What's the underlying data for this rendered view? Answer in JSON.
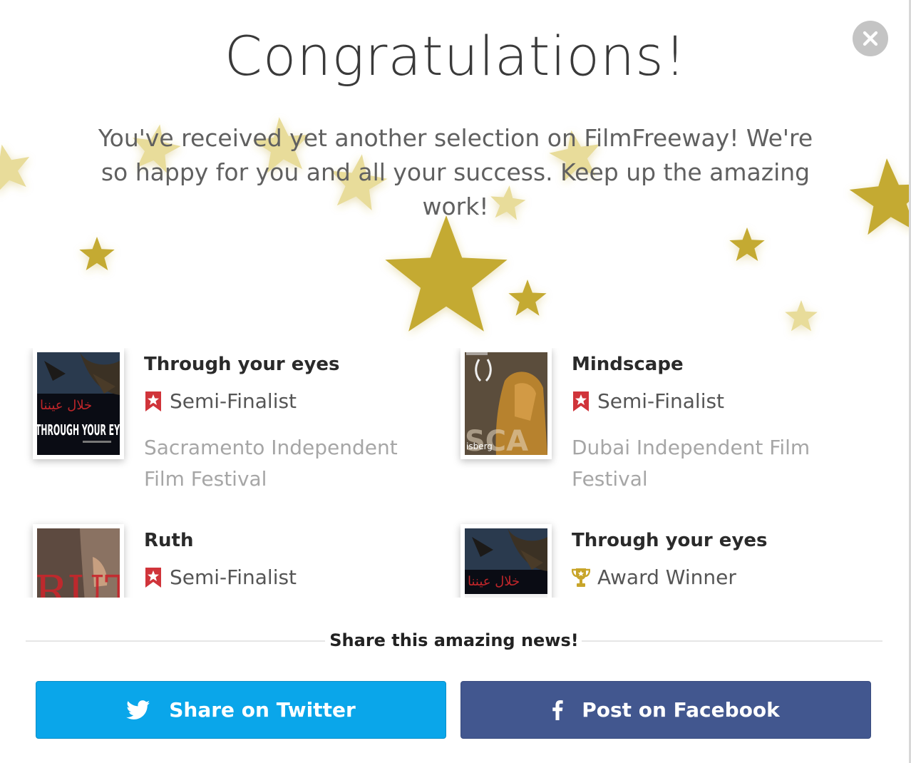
{
  "modal": {
    "title": "Congratulations!",
    "message": "You've received yet another selection on FilmFreeway! We're so happy for you and all your success. Keep up the amazing work!",
    "close_icon": "close-icon",
    "star_colors": {
      "gold": "#c4aa31",
      "pale": "#e8dc9a"
    }
  },
  "selections": [
    {
      "title": "Through your eyes",
      "status": "Semi-Finalist",
      "status_icon": "semi-finalist-badge-icon",
      "festival": "Sacramento Independent Film Festival",
      "poster_text": "THROUGH YOUR EY"
    },
    {
      "title": "Mindscape",
      "status": "Semi-Finalist",
      "status_icon": "semi-finalist-badge-icon",
      "festival": "Dubai Independent Film Festival",
      "poster_text": "isberg"
    },
    {
      "title": "Ruth",
      "status": "Semi-Finalist",
      "status_icon": "semi-finalist-badge-icon",
      "festival": "",
      "poster_text": "RUTH"
    },
    {
      "title": "Through your eyes",
      "status": "Award Winner",
      "status_icon": "trophy-icon",
      "festival": "",
      "poster_text": ""
    }
  ],
  "share": {
    "heading": "Share this amazing news!",
    "twitter_label": "Share on Twitter",
    "facebook_label": "Post on Facebook",
    "colors": {
      "twitter": "#0aa6ea",
      "facebook": "#42578f",
      "badge_red": "#d0343a",
      "trophy_gold": "#c8a52a"
    }
  }
}
